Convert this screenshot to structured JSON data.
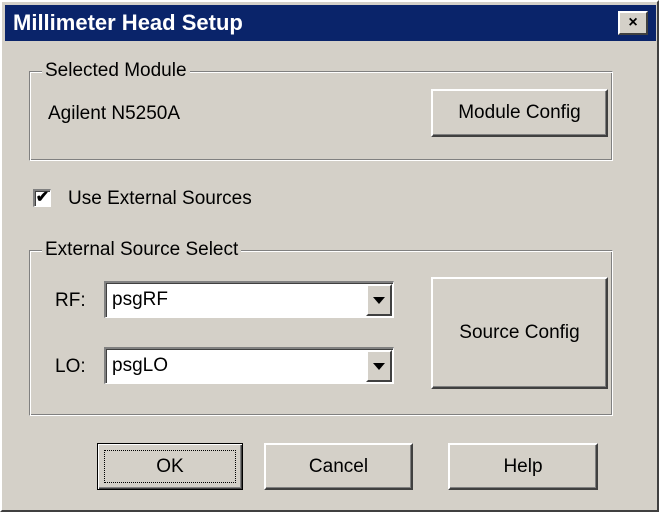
{
  "window": {
    "title": "Millimeter Head Setup",
    "close_glyph": "×"
  },
  "selected_module": {
    "group_label": "Selected Module",
    "module_name": "Agilent N5250A",
    "config_button": "Module Config"
  },
  "external_sources": {
    "checkbox_label": "Use External Sources",
    "checked": true,
    "check_glyph": "✔"
  },
  "source_select": {
    "group_label": "External Source Select",
    "rf_label": "RF:",
    "rf_value": "psgRF",
    "lo_label": "LO:",
    "lo_value": "psgLO",
    "config_button": "Source Config"
  },
  "buttons": {
    "ok": "OK",
    "cancel": "Cancel",
    "help": "Help"
  },
  "colors": {
    "titlebar": "#0a246a",
    "face": "#d4d0c8"
  }
}
